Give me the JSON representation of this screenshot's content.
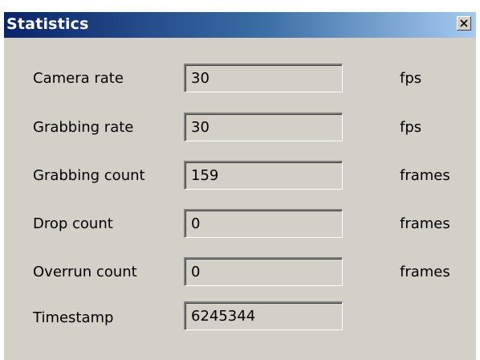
{
  "window": {
    "title": "Statistics"
  },
  "rows": [
    {
      "label": "Camera rate",
      "value": "30",
      "unit": "fps"
    },
    {
      "label": "Grabbing rate",
      "value": "30",
      "unit": "fps"
    },
    {
      "label": "Grabbing count",
      "value": "159",
      "unit": "frames"
    },
    {
      "label": "Drop count",
      "value": "0",
      "unit": "frames"
    },
    {
      "label": "Overrun count",
      "value": "0",
      "unit": "frames"
    },
    {
      "label": "Timestamp",
      "value": "6245344",
      "unit": ""
    }
  ],
  "colors": {
    "dialog_background": "#d4d0c8",
    "titlebar_start": "#0a246a",
    "titlebar_end": "#a6caf0",
    "title_text": "#ffffff"
  },
  "icons": {
    "close": "close-icon"
  }
}
